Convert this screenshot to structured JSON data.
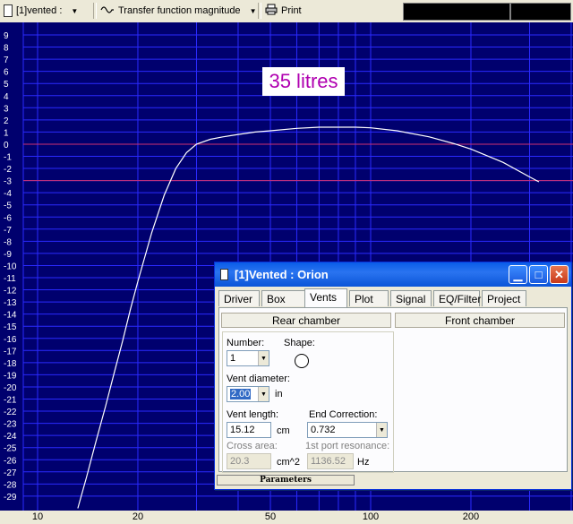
{
  "toolbar": {
    "project_select": "[1]vented :",
    "plot_select": "Transfer function magnitude",
    "print_label": "Print"
  },
  "chart_data": {
    "type": "line",
    "annotation": "35 litres",
    "x_scale": "log",
    "xlim": [
      8,
      320
    ],
    "ylim": [
      -30,
      10
    ],
    "x_ticks": [
      "10",
      "20",
      "50",
      "100",
      "200"
    ],
    "y_ticks": [
      "9",
      "8",
      "7",
      "6",
      "5",
      "4",
      "3",
      "2",
      "1",
      "0",
      "-1",
      "-2",
      "-3",
      "-4",
      "-5",
      "-6",
      "-7",
      "-8",
      "-9",
      "-10",
      "-11",
      "-12",
      "-13",
      "-14",
      "-15",
      "-16",
      "-17",
      "-18",
      "-19",
      "-20",
      "-21",
      "-22",
      "-23",
      "-24",
      "-25",
      "-26",
      "-27",
      "-28",
      "-29"
    ],
    "reference_lines": [
      0,
      -3
    ],
    "grid": true,
    "colors": {
      "background": "#00006e",
      "grid": "#2a2aff",
      "curve": "#ffffff",
      "reference": "#d03070"
    },
    "series": [
      {
        "x": [
          13.2,
          14,
          15,
          16,
          17,
          18,
          19,
          20,
          22,
          24,
          26,
          28,
          30,
          33,
          36,
          40,
          45,
          50,
          60,
          70,
          80,
          90,
          100,
          120,
          150,
          180,
          200,
          250,
          300,
          320
        ],
        "y": [
          -30,
          -27.5,
          -24.4,
          -21.6,
          -18.8,
          -16.2,
          -13.6,
          -11.3,
          -7.3,
          -4.2,
          -2.0,
          -0.7,
          0.0,
          0.4,
          0.6,
          0.8,
          1.0,
          1.1,
          1.3,
          1.4,
          1.4,
          1.4,
          1.35,
          1.1,
          0.6,
          0.0,
          -0.4,
          -1.5,
          -2.7,
          -3.1
        ]
      }
    ]
  },
  "dialog": {
    "title": "[1]Vented : Orion",
    "tabs": [
      "Driver",
      "Box",
      "Vents",
      "Plot",
      "Signal",
      "EQ/Filter",
      "Project"
    ],
    "active_tab": "Vents",
    "rear_chamber_label": "Rear chamber",
    "front_chamber_label": "Front chamber",
    "number_label": "Number:",
    "number_value": "1",
    "shape_label": "Shape:",
    "vent_diameter_label": "Vent diameter:",
    "vent_diameter_value": "2.00",
    "vent_diameter_unit": "in",
    "vent_length_label": "Vent length:",
    "vent_length_value": "15.12",
    "vent_length_unit": "cm",
    "end_correction_label": "End Correction:",
    "end_correction_value": "0.732",
    "cross_area_label": "Cross area:",
    "cross_area_value": "20.3",
    "cross_area_unit": "cm^2",
    "port_resonance_label": "1st port resonance:",
    "port_resonance_value": "1136.52",
    "port_resonance_unit": "Hz",
    "status": "Parameters"
  }
}
